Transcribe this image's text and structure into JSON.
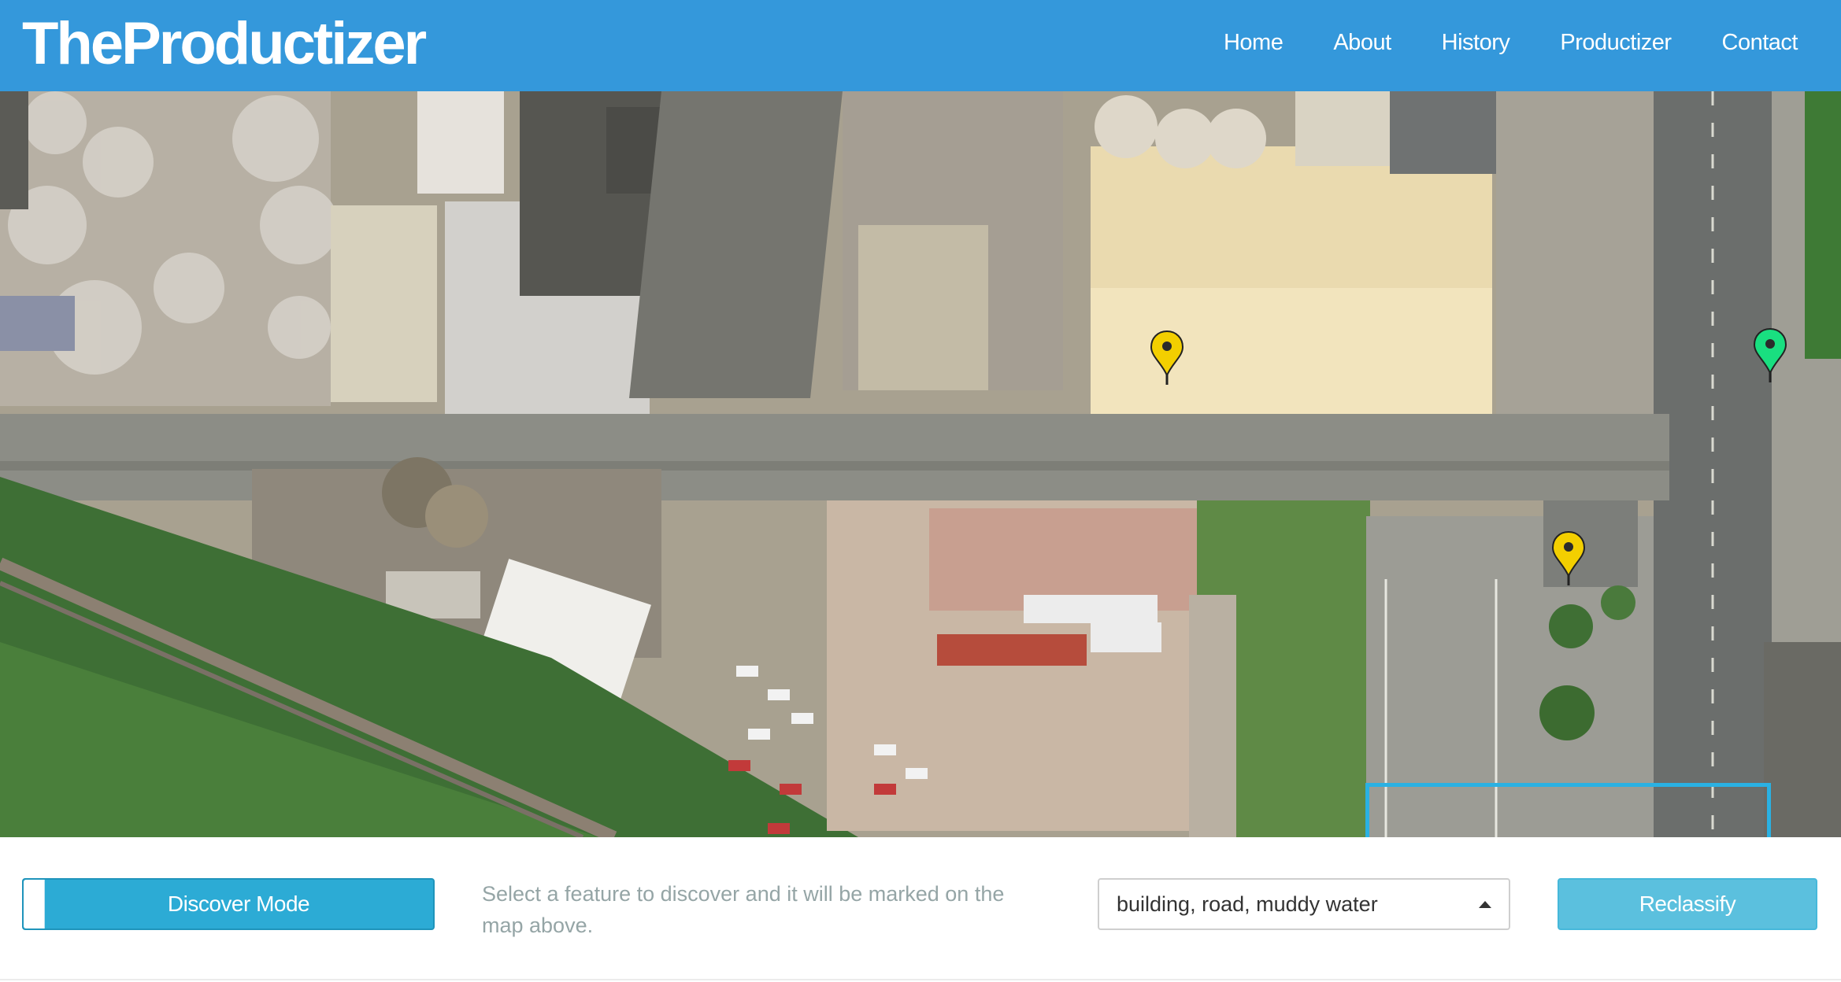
{
  "header": {
    "brand": "TheProductizer",
    "nav": [
      "Home",
      "About",
      "History",
      "Productizer",
      "Contact"
    ]
  },
  "map": {
    "markers": [
      {
        "color": "#f3cf00",
        "label": "yellow-marker"
      },
      {
        "color": "#f3cf00",
        "label": "yellow-marker"
      },
      {
        "color": "#19df80",
        "label": "green-marker"
      }
    ],
    "selection_color": "#2ab1e3"
  },
  "controls": {
    "mode_toggle": "Discover Mode",
    "hint": "Select a feature to discover and it will be marked on the map above.",
    "feature_select": "building, road, muddy water",
    "reclassify": "Reclassify"
  },
  "colors": {
    "navbar": "#3498db",
    "toggle": "#2cabd5",
    "reclassify": "#5bc0de"
  }
}
